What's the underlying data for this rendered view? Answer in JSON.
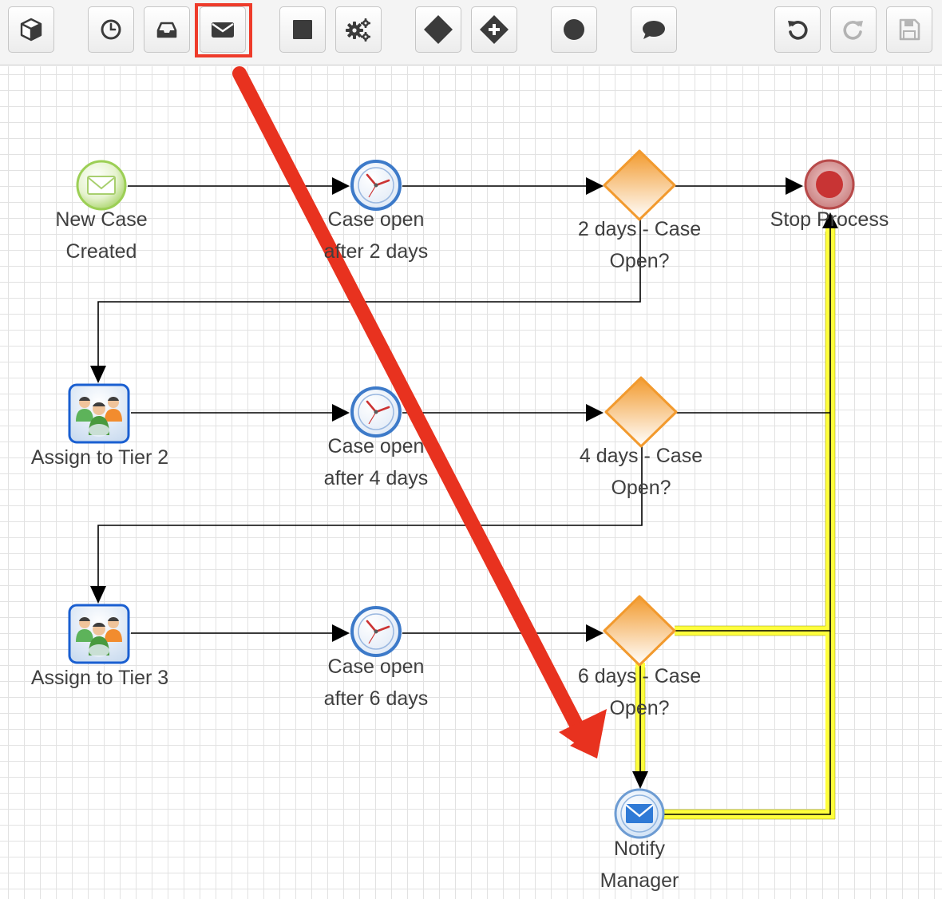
{
  "toolbar": {
    "buttons": [
      {
        "icon": "cube-icon",
        "label": "Start Event"
      },
      {
        "icon": "clock-icon",
        "label": "Intermediate Timer Event"
      },
      {
        "icon": "inbox-icon",
        "label": "Receive Message Event"
      },
      {
        "icon": "envelope-icon",
        "label": "Send Message Event",
        "highlighted": true
      },
      {
        "icon": "square-icon",
        "label": "Activity"
      },
      {
        "icon": "gears-icon",
        "label": "Action"
      },
      {
        "icon": "diamond-icon",
        "label": "Exclusive Gateway"
      },
      {
        "icon": "diamond-plus-icon",
        "label": "Parallel Gateway"
      },
      {
        "icon": "circle-icon",
        "label": "End Event"
      },
      {
        "icon": "comment-icon",
        "label": "Comment"
      },
      {
        "icon": "undo-icon",
        "label": "Undo"
      },
      {
        "icon": "redo-icon",
        "label": "Redo",
        "disabled": true
      },
      {
        "icon": "save-icon",
        "label": "Save",
        "disabled": true
      }
    ]
  },
  "nodes": {
    "start": {
      "line1": "New Case",
      "line2": "Created"
    },
    "timer1": {
      "line1": "Case open",
      "line2": "after 2 days"
    },
    "gateway1": {
      "line1": "2 days - Case",
      "line2": "Open?"
    },
    "end": {
      "line1": "Stop Process"
    },
    "assign2": {
      "line1": "Assign to Tier 2"
    },
    "timer2": {
      "line1": "Case open",
      "line2": "after 4 days"
    },
    "gateway2": {
      "line1": "4 days - Case",
      "line2": "Open?"
    },
    "assign3": {
      "line1": "Assign to Tier 3"
    },
    "timer3": {
      "line1": "Case open",
      "line2": "after 6 days"
    },
    "gateway3": {
      "line1": "6 days - Case",
      "line2": "Open?"
    },
    "notify": {
      "line1": "Notify",
      "line2": "Manager"
    }
  },
  "colors": {
    "highlight_box": "#ee3b2a",
    "drag_arrow": "#e8321f",
    "selected_flow": "#ffff3c",
    "flow_line": "#000000",
    "gateway": "#f29a2e",
    "end_event": "#c83434",
    "start_event": "#9ccf55"
  }
}
